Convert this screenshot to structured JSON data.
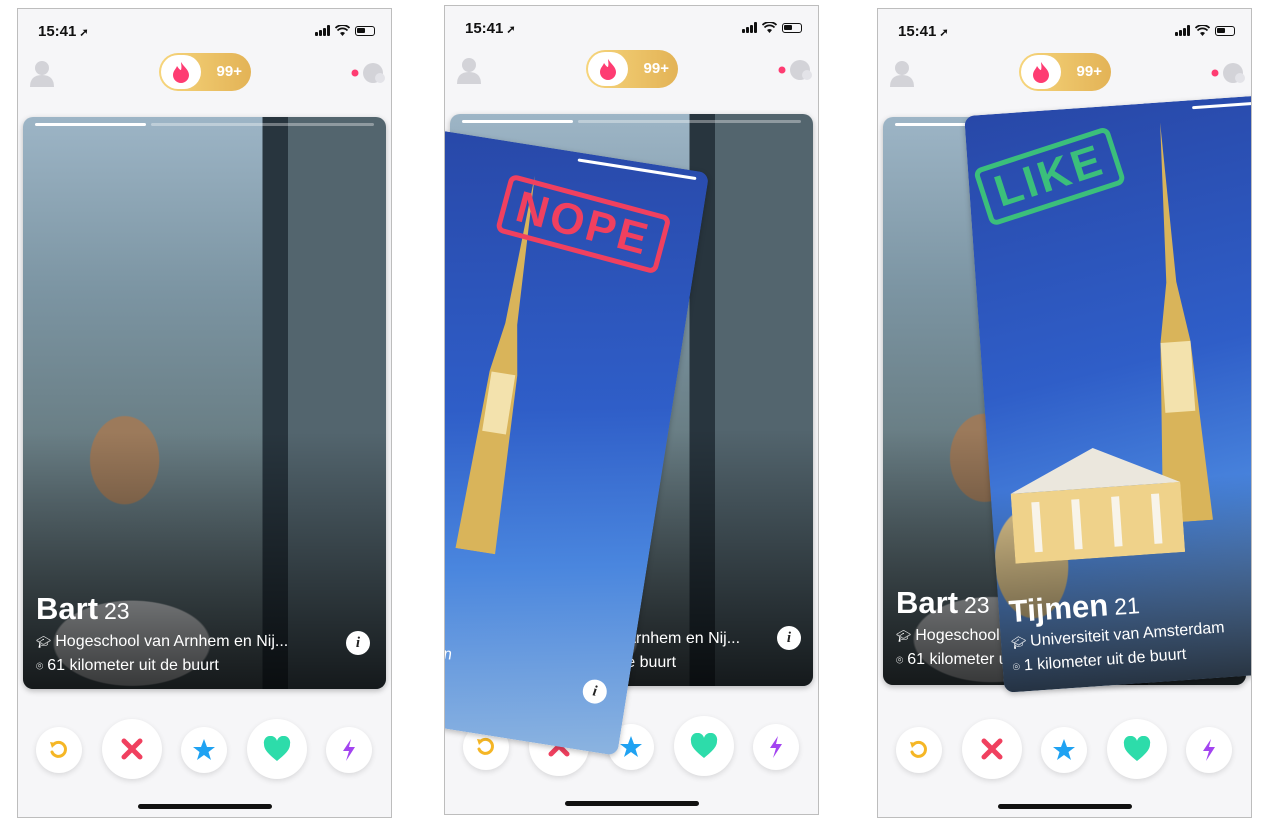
{
  "status": {
    "time": "15:41",
    "location_icon": "location-arrow-icon"
  },
  "header": {
    "badge_count": "99+",
    "profile_icon": "profile-icon",
    "flame_icon": "flame-icon",
    "chat_icon": "chat-icon"
  },
  "bart": {
    "name": "Bart",
    "age": "23",
    "school": "Hogeschool van Arnhem en Nij...",
    "school_cut_2": "van Arnhem en Nij...",
    "school_cut_3": "Hogeschool",
    "distance": "61 kilometer uit de buurt",
    "distance_cut_2": "uit de buurt",
    "distance_cut_3": "61 kilometer u"
  },
  "tijmen": {
    "name": "Tijmen",
    "age": "21",
    "school": "Universiteit van Amsterdam",
    "school_cut_2": "dam",
    "distance": "1 kilometer uit de buurt"
  },
  "stamps": {
    "nope": "NOPE",
    "like": "LIKE"
  },
  "actions": {
    "rewind_icon": "rewind-icon",
    "nope_icon": "close-icon",
    "superlike_icon": "star-icon",
    "like_icon": "heart-icon",
    "boost_icon": "bolt-icon"
  },
  "colors": {
    "rewind": "#f5b625",
    "nope": "#f0405f",
    "superlike": "#1fa2f2",
    "like": "#2ddcaa",
    "boost": "#a344f0",
    "gold": "#e7bd5f",
    "flame": "#fe3c72"
  }
}
